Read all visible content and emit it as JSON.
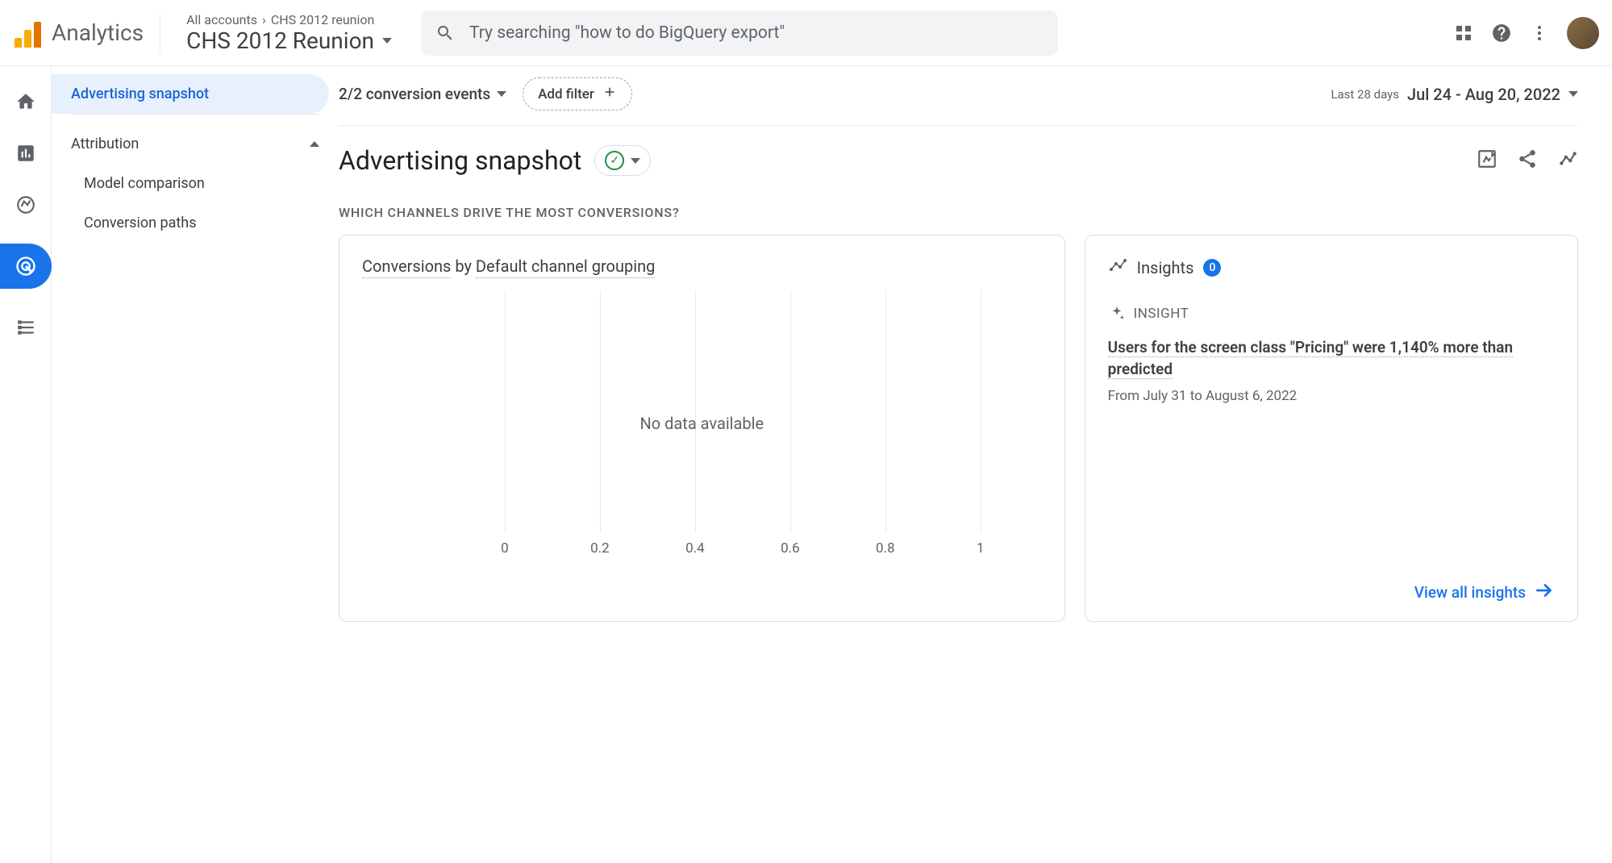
{
  "header": {
    "product": "Analytics",
    "breadcrumb_root": "All accounts",
    "breadcrumb_leaf": "CHS 2012 reunion",
    "property": "CHS 2012 Reunion",
    "search_placeholder": "Try searching \"how to do BigQuery export\""
  },
  "sidebar": {
    "active": "Advertising snapshot",
    "section": "Attribution",
    "items": [
      "Model comparison",
      "Conversion paths"
    ]
  },
  "toolbar": {
    "conversion_events": "2/2 conversion events",
    "add_filter": "Add filter",
    "date_range_label": "Last 28 days",
    "date_range_value": "Jul 24 - Aug 20, 2022"
  },
  "page": {
    "title": "Advertising snapshot",
    "section_heading": "WHICH CHANNELS DRIVE THE MOST CONVERSIONS?"
  },
  "chart_card": {
    "title_metric": "Conversions",
    "title_mid": " by ",
    "title_dimension": "Default channel grouping",
    "no_data": "No data available"
  },
  "chart_data": {
    "type": "bar",
    "categories": [],
    "values": [],
    "xlabel": "",
    "ylabel": "",
    "xlim": [
      0,
      1
    ],
    "ticks": [
      0,
      0.2,
      0.4,
      0.6,
      0.8,
      1
    ],
    "tick_labels": [
      "0",
      "0.2",
      "0.4",
      "0.6",
      "0.8",
      "1"
    ],
    "title": "Conversions by Default channel grouping"
  },
  "insights": {
    "title": "Insights",
    "badge": "0",
    "label": "INSIGHT",
    "text": "Users for the screen class \"Pricing\" were 1,140% more than predicted",
    "date_range": "From July 31 to August 6, 2022",
    "view_all": "View all insights"
  }
}
